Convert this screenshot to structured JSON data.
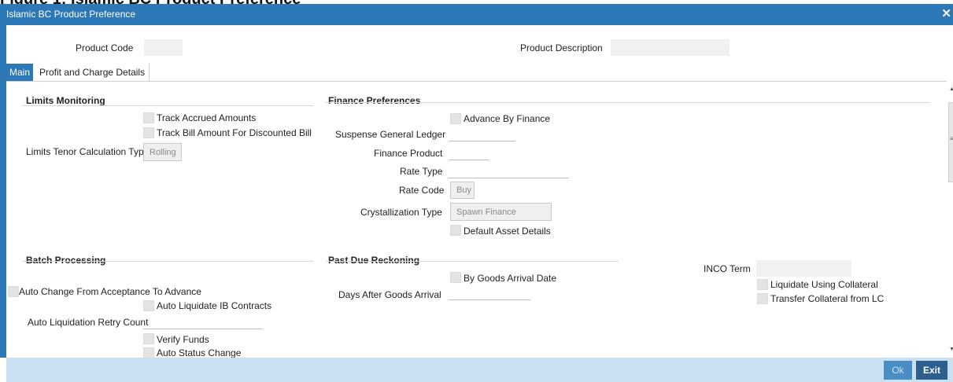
{
  "caption": "Figure 1: Islamic BC Product Preference",
  "window": {
    "title": "Islamic BC Product Preference",
    "close_glyph": "✕"
  },
  "header": {
    "product_code_label": "Product Code",
    "product_description_label": "Product Description"
  },
  "tabs": [
    {
      "label": "Main",
      "active": true
    },
    {
      "label": "Profit and Charge Details",
      "active": false
    }
  ],
  "limits_monitoring": {
    "heading": "Limits Monitoring",
    "track_accrued_amounts": "Track Accrued Amounts",
    "track_bill_amount": "Track Bill Amount For Discounted Bill",
    "tenor_calc_label": "Limits Tenor Calculation Type",
    "tenor_calc_value": "Rolling"
  },
  "finance_preferences": {
    "heading": "Finance Preferences",
    "advance_by_finance": "Advance By Finance",
    "suspense_gl_label": "Suspense General Ledger",
    "finance_product_label": "Finance Product",
    "rate_type_label": "Rate Type",
    "rate_code_label": "Rate Code",
    "rate_code_value": "Buy",
    "crystallization_type_label": "Crystallization Type",
    "crystallization_type_value": "Spawn Finance",
    "default_asset_details": "Default Asset Details"
  },
  "batch_processing": {
    "heading": "Batch Processing",
    "auto_change": "Auto Change From Acceptance To Advance",
    "auto_liquidate": "Auto Liquidate IB Contracts",
    "retry_count_label": "Auto Liquidation Retry Count",
    "verify_funds": "Verify Funds",
    "auto_status_change": "Auto Status Change"
  },
  "past_due_reckoning": {
    "heading": "Past Due Reckoning",
    "by_goods_arrival": "By Goods Arrival Date",
    "days_after_label": "Days After Goods Arrival"
  },
  "inco": {
    "inco_term_label": "INCO Term",
    "liquidate_using_collateral": "Liquidate Using Collateral",
    "transfer_collateral": "Transfer Collateral from LC"
  },
  "footer": {
    "ok_label": "Ok",
    "exit_label": "Exit"
  },
  "colors": {
    "titlebar": "#2d78b7",
    "footer": "#c9e0f2",
    "exit_button": "#2d5f8e"
  }
}
